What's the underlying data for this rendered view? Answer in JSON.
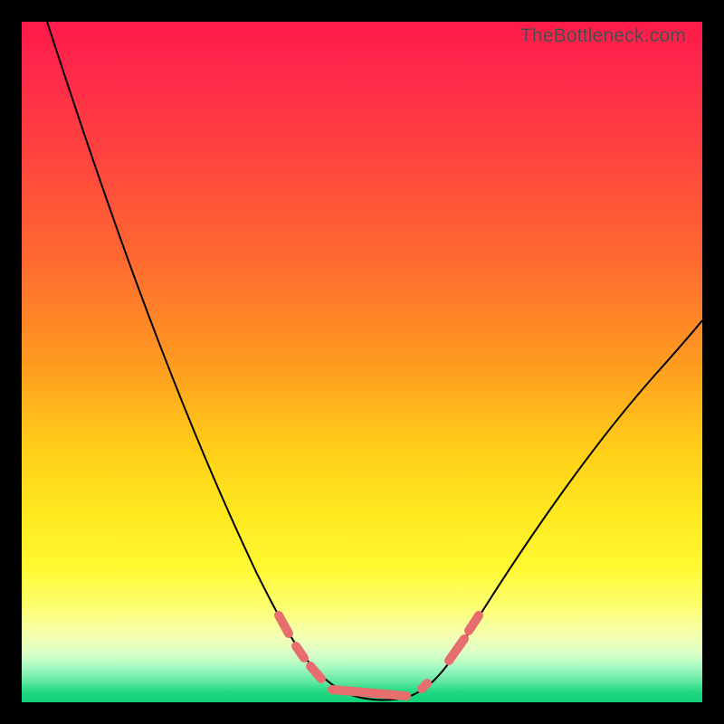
{
  "watermark": "TheBottleneck.com",
  "chart_data": {
    "type": "line",
    "title": "",
    "xlabel": "",
    "ylabel": "",
    "xlim": [
      0,
      100
    ],
    "ylim": [
      0,
      100
    ],
    "x": [
      0,
      5,
      10,
      15,
      20,
      25,
      30,
      35,
      40,
      42,
      45,
      48,
      52,
      55,
      57,
      60,
      65,
      70,
      75,
      80,
      85,
      90,
      95,
      100
    ],
    "values": [
      100,
      90,
      79,
      68,
      57,
      46,
      35,
      24,
      13,
      9,
      5,
      2,
      1,
      2,
      4,
      7,
      12,
      18,
      24,
      31,
      38,
      45,
      52,
      59
    ],
    "optimal_band": {
      "x_start": 42,
      "x_end": 60,
      "y_max": 13
    },
    "gradient_scale": [
      {
        "pos": 0,
        "color": "#ff1a4a",
        "meaning": "worst"
      },
      {
        "pos": 50,
        "color": "#ff9a20",
        "meaning": "bad"
      },
      {
        "pos": 80,
        "color": "#fff830",
        "meaning": "ok"
      },
      {
        "pos": 100,
        "color": "#10d078",
        "meaning": "best"
      }
    ]
  }
}
